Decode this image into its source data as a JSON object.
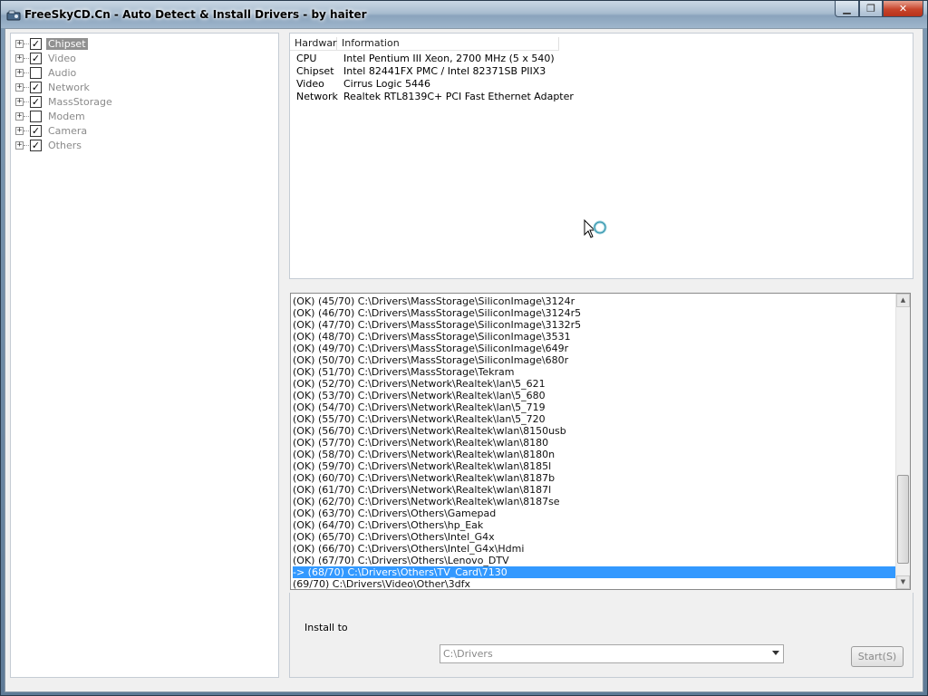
{
  "window": {
    "title": "FreeSkyCD.Cn - Auto Detect & Install Drivers - by haiter",
    "minimize_glyph": "▁",
    "maximize_glyph": "❐",
    "close_glyph": "✕"
  },
  "tree": {
    "items": [
      {
        "label": "Chipset",
        "checked": true,
        "selected": true
      },
      {
        "label": "Video",
        "checked": true
      },
      {
        "label": "Audio",
        "checked": false
      },
      {
        "label": "Network",
        "checked": true
      },
      {
        "label": "MassStorage",
        "checked": true
      },
      {
        "label": "Modem",
        "checked": false
      },
      {
        "label": "Camera",
        "checked": true
      },
      {
        "label": "Others",
        "checked": true
      }
    ]
  },
  "hardware": {
    "headers": [
      "Hardwar",
      "Information"
    ],
    "rows": [
      [
        "CPU",
        "Intel Pentium III Xeon, 2700 MHz (5 x 540)"
      ],
      [
        "Chipset",
        "Intel 82441FX PMC / Intel 82371SB PIIX3"
      ],
      [
        "Video",
        "Cirrus Logic 5446"
      ],
      [
        "Network",
        "Realtek RTL8139C+ PCI Fast Ethernet Adapter"
      ]
    ]
  },
  "log": {
    "rows": [
      "(OK) (45/70) C:\\Drivers\\MassStorage\\SiliconImage\\3124r",
      "(OK) (46/70) C:\\Drivers\\MassStorage\\SiliconImage\\3124r5",
      "(OK) (47/70) C:\\Drivers\\MassStorage\\SiliconImage\\3132r5",
      "(OK) (48/70) C:\\Drivers\\MassStorage\\SiliconImage\\3531",
      "(OK) (49/70) C:\\Drivers\\MassStorage\\SiliconImage\\649r",
      "(OK) (50/70) C:\\Drivers\\MassStorage\\SiliconImage\\680r",
      "(OK) (51/70) C:\\Drivers\\MassStorage\\Tekram",
      "(OK) (52/70) C:\\Drivers\\Network\\Realtek\\lan\\5_621",
      "(OK) (53/70) C:\\Drivers\\Network\\Realtek\\lan\\5_680",
      "(OK) (54/70) C:\\Drivers\\Network\\Realtek\\lan\\5_719",
      "(OK) (55/70) C:\\Drivers\\Network\\Realtek\\lan\\5_720",
      "(OK) (56/70) C:\\Drivers\\Network\\Realtek\\wlan\\8150usb",
      "(OK) (57/70) C:\\Drivers\\Network\\Realtek\\wlan\\8180",
      "(OK) (58/70) C:\\Drivers\\Network\\Realtek\\wlan\\8180n",
      "(OK) (59/70) C:\\Drivers\\Network\\Realtek\\wlan\\8185l",
      "(OK) (60/70) C:\\Drivers\\Network\\Realtek\\wlan\\8187b",
      "(OK) (61/70) C:\\Drivers\\Network\\Realtek\\wlan\\8187l",
      "(OK) (62/70) C:\\Drivers\\Network\\Realtek\\wlan\\8187se",
      "(OK) (63/70) C:\\Drivers\\Others\\Gamepad",
      "(OK) (64/70) C:\\Drivers\\Others\\hp_Eak",
      "(OK) (65/70) C:\\Drivers\\Others\\Intel_G4x",
      "(OK) (66/70) C:\\Drivers\\Others\\Intel_G4x\\Hdmi",
      "(OK) (67/70) C:\\Drivers\\Others\\Lenovo_DTV",
      "-> (68/70) C:\\Drivers\\Others\\TV_Card\\7130",
      "(69/70) C:\\Drivers\\Video\\Other\\3dfx"
    ],
    "highlight_index": 23
  },
  "install": {
    "label": "Install to",
    "path": "C:\\Drivers",
    "start_label": "Start(S)"
  },
  "colors": {
    "highlight": "#3399ff",
    "tree_selected": "#919191"
  }
}
